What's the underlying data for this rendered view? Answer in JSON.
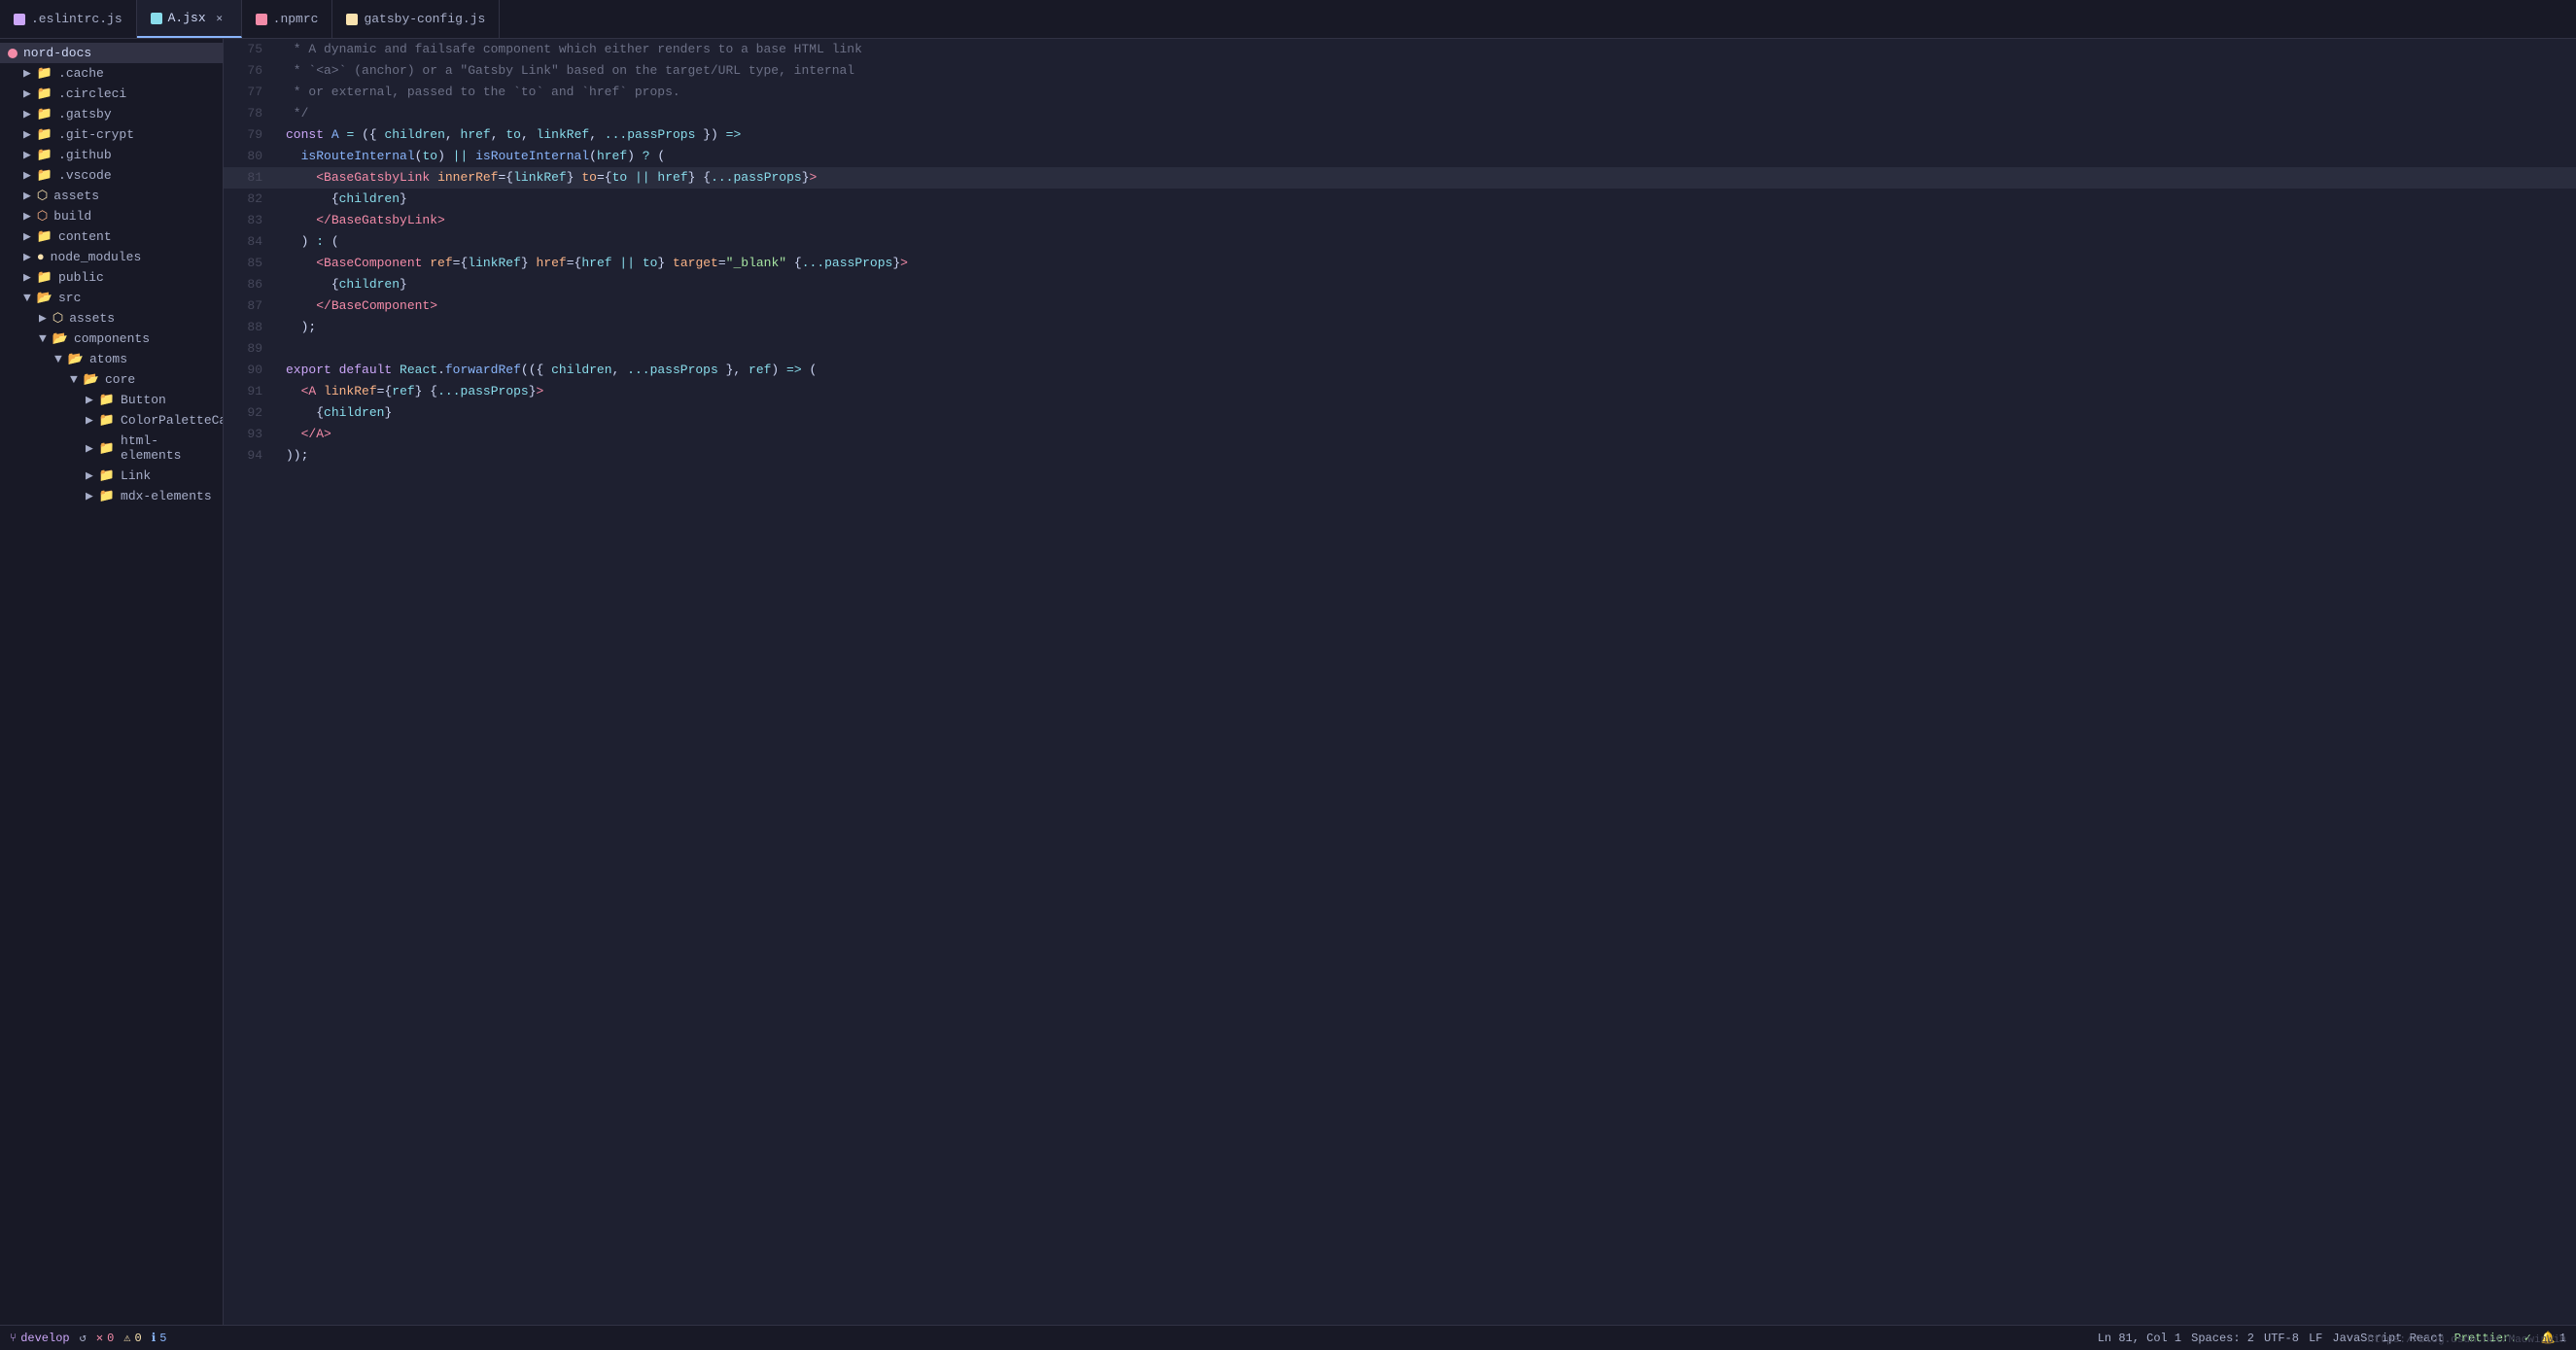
{
  "tabs": [
    {
      "id": "eslint",
      "label": ".eslintrc.js",
      "icon_color": "sq-purple",
      "active": false,
      "has_close": false
    },
    {
      "id": "jsx",
      "label": "A.jsx",
      "icon_color": "sq-cyan",
      "active": true,
      "has_close": true
    },
    {
      "id": "npmrc",
      "label": ".npmrc",
      "icon_color": "sq-red",
      "active": false,
      "has_close": false
    },
    {
      "id": "gatsby",
      "label": "gatsby-config.js",
      "icon_color": "sq-yellow",
      "active": false,
      "has_close": false
    }
  ],
  "sidebar": {
    "root": "nord-docs",
    "items": [
      {
        "label": ".cache",
        "type": "folder",
        "indent": 1,
        "icon": "📁"
      },
      {
        "label": ".circleci",
        "type": "folder",
        "indent": 1,
        "icon": "📁"
      },
      {
        "label": ".gatsby",
        "type": "folder",
        "indent": 1,
        "icon": "📁"
      },
      {
        "label": ".git-crypt",
        "type": "folder",
        "indent": 1,
        "icon": "📁"
      },
      {
        "label": ".github",
        "type": "folder",
        "indent": 1,
        "icon": "📁"
      },
      {
        "label": ".vscode",
        "type": "folder",
        "indent": 1,
        "icon": "📁"
      },
      {
        "label": "assets",
        "type": "folder_special",
        "indent": 1,
        "icon": "📦"
      },
      {
        "label": "build",
        "type": "folder_special2",
        "indent": 1,
        "icon": "📦"
      },
      {
        "label": "content",
        "type": "folder",
        "indent": 1,
        "icon": "📁"
      },
      {
        "label": "node_modules",
        "type": "folder_dot_yellow",
        "indent": 1,
        "icon": "📁"
      },
      {
        "label": "public",
        "type": "folder",
        "indent": 1,
        "icon": "📁"
      },
      {
        "label": "src",
        "type": "folder_src",
        "indent": 1,
        "icon": "📁"
      },
      {
        "label": "assets",
        "type": "folder_assets_inner",
        "indent": 2,
        "icon": "📦"
      },
      {
        "label": "components",
        "type": "folder",
        "indent": 2,
        "icon": "📁"
      },
      {
        "label": "atoms",
        "type": "folder",
        "indent": 3,
        "icon": "📁"
      },
      {
        "label": "core",
        "type": "folder",
        "indent": 4,
        "icon": "📁"
      },
      {
        "label": "Button",
        "type": "folder",
        "indent": 4,
        "icon": "📁"
      },
      {
        "label": "ColorPaletteCard",
        "type": "folder",
        "indent": 4,
        "icon": "📁"
      },
      {
        "label": "html-elements",
        "type": "folder",
        "indent": 4,
        "icon": "📁"
      },
      {
        "label": "Link",
        "type": "folder",
        "indent": 4,
        "icon": "📁"
      },
      {
        "label": "mdx-elements",
        "type": "folder",
        "indent": 4,
        "icon": "📁"
      }
    ]
  },
  "code_lines": [
    {
      "num": 75,
      "highlighted": false
    },
    {
      "num": 76,
      "highlighted": false
    },
    {
      "num": 77,
      "highlighted": false
    },
    {
      "num": 78,
      "highlighted": false
    },
    {
      "num": 79,
      "highlighted": false
    },
    {
      "num": 80,
      "highlighted": false
    },
    {
      "num": 81,
      "highlighted": true
    },
    {
      "num": 82,
      "highlighted": false
    },
    {
      "num": 83,
      "highlighted": false
    },
    {
      "num": 84,
      "highlighted": false
    },
    {
      "num": 85,
      "highlighted": false
    },
    {
      "num": 86,
      "highlighted": false
    },
    {
      "num": 87,
      "highlighted": false
    },
    {
      "num": 88,
      "highlighted": false
    },
    {
      "num": 89,
      "highlighted": false
    },
    {
      "num": 90,
      "highlighted": false
    },
    {
      "num": 91,
      "highlighted": false
    },
    {
      "num": 92,
      "highlighted": false
    },
    {
      "num": 93,
      "highlighted": false
    },
    {
      "num": 94,
      "highlighted": false
    }
  ],
  "status": {
    "branch": "develop",
    "errors": "0",
    "warnings": "0",
    "info": "5",
    "position": "Ln 81, Col 1",
    "spaces": "Spaces: 2",
    "encoding": "UTF-8",
    "line_ending": "LF",
    "language": "JavaScript React",
    "formatter": "Prettier: ✓",
    "notifications": "1"
  },
  "watermark": "https://blog.csdn.net/MacwinWin"
}
